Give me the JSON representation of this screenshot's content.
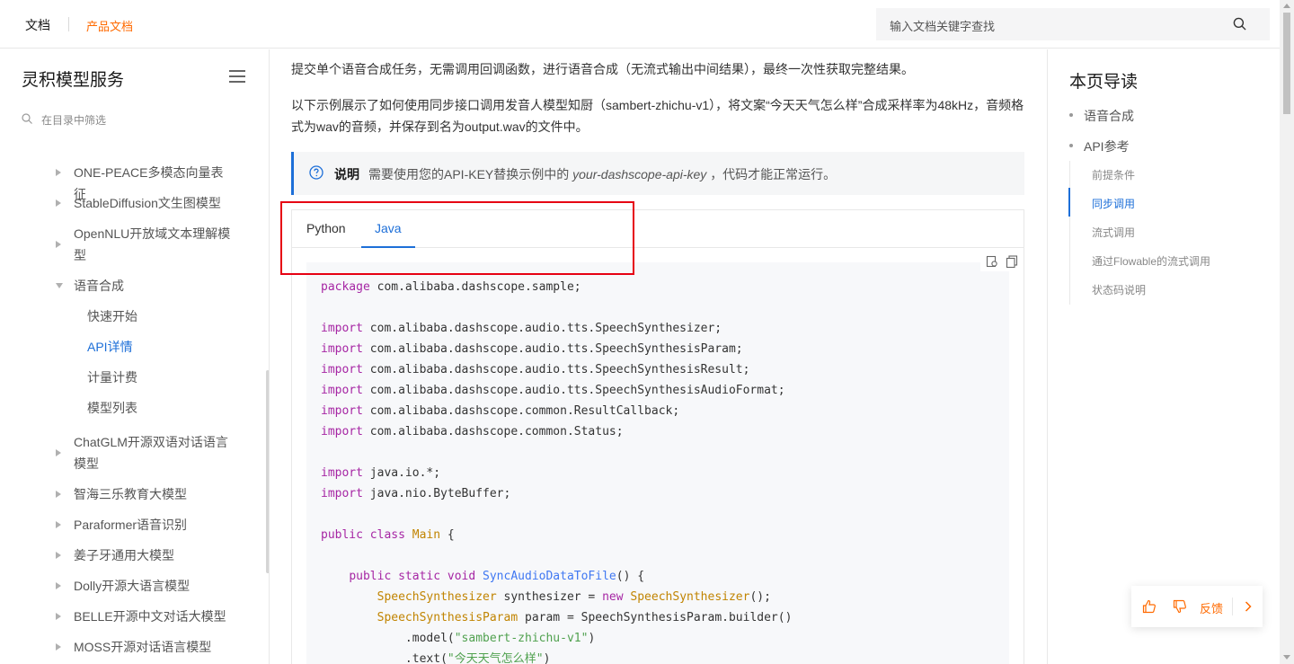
{
  "header": {
    "brand": "文档",
    "product": "产品文档",
    "search_placeholder": "输入文档关键字查找",
    "search_icon": "search-icon"
  },
  "sidebar": {
    "title": "灵积模型服务",
    "filter_placeholder": "在目录中筛选",
    "items": [
      {
        "label": "ONE-PEACE多模态向量表征",
        "expanded": false
      },
      {
        "label": "StableDiffusion文生图模型",
        "expanded": false
      },
      {
        "label": "OpenNLU开放域文本理解模型",
        "expanded": false
      },
      {
        "label": "语音合成",
        "expanded": true
      },
      {
        "label": "ChatGLM开源双语对话语言模型",
        "expanded": false
      },
      {
        "label": "智海三乐教育大模型",
        "expanded": false
      },
      {
        "label": "Paraformer语音识别",
        "expanded": false
      },
      {
        "label": "姜子牙通用大模型",
        "expanded": false
      },
      {
        "label": "Dolly开源大语言模型",
        "expanded": false
      },
      {
        "label": "BELLE开源中文对话大模型",
        "expanded": false
      },
      {
        "label": "MOSS开源对话语言模型",
        "expanded": false
      }
    ],
    "sub_items": [
      {
        "label": "快速开始",
        "active": false
      },
      {
        "label": "API详情",
        "active": true
      },
      {
        "label": "计量计费",
        "active": false
      },
      {
        "label": "模型列表",
        "active": false
      }
    ]
  },
  "content": {
    "para1": "提交单个语音合成任务，无需调用回调函数，进行语音合成（无流式输出中间结果），最终一次性获取完整结果。",
    "para2": "以下示例展示了如何使用同步接口调用发音人模型知厨（sambert-zhichu-v1），将文案“今天天气怎么样”合成采样率为48kHz，音频格式为wav的音频，并保存到名为output.wav的文件中。",
    "note_label": "说明",
    "note_text_before": "需要使用您的API-KEY替换示例中的",
    "note_text_italic": "your-dashscope-api-key",
    "note_text_after": "，代码才能正常运行。",
    "tabs": [
      {
        "label": "Python",
        "active": false
      },
      {
        "label": "Java",
        "active": true
      }
    ],
    "code": {
      "l1_kw": "package",
      "l1": " com.alibaba.dashscope.sample;",
      "imp": "import",
      "i1": " com.alibaba.dashscope.audio.tts.SpeechSynthesizer;",
      "i2": " com.alibaba.dashscope.audio.tts.SpeechSynthesisParam;",
      "i3": " com.alibaba.dashscope.audio.tts.SpeechSynthesisResult;",
      "i4": " com.alibaba.dashscope.audio.tts.SpeechSynthesisAudioFormat;",
      "i5": " com.alibaba.dashscope.common.ResultCallback;",
      "i6": " com.alibaba.dashscope.common.Status;",
      "i7": " java.io.*;",
      "i8": " java.nio.ByteBuffer;",
      "cls_kw": "public class",
      "cls_name": "Main",
      "cls_end": " {",
      "m_kw": "public static void",
      "m_name": "SyncAudioDataToFile",
      "m_end": "() {",
      "s1_ty": "SpeechSynthesizer",
      "s1_var": " synthesizer = ",
      "s1_new": "new",
      "s1_ty2": "SpeechSynthesizer",
      "s1_end": "();",
      "s2_ty": "SpeechSynthesisParam",
      "s2_rest": " param = SpeechSynthesisParam.builder()",
      "s3_pre": "  .model(",
      "s3_str": "\"sambert-zhichu-v1\"",
      "s3_end": ")",
      "s4_pre": "  .text(",
      "s4_str": "\"今天天气怎么样\"",
      "s4_end": ")"
    }
  },
  "toc": {
    "title": "本页导读",
    "level1": [
      {
        "label": "语音合成"
      },
      {
        "label": "API参考"
      }
    ],
    "level2": [
      {
        "label": "前提条件",
        "active": false
      },
      {
        "label": "同步调用",
        "active": true
      },
      {
        "label": "流式调用",
        "active": false
      },
      {
        "label": "通过Flowable的流式调用",
        "active": false
      },
      {
        "label": "状态码说明",
        "active": false
      }
    ]
  },
  "feedback": {
    "label": "反馈"
  },
  "colors": {
    "accent": "#1d6fd8",
    "brand_orange": "#ff6a00",
    "highlight_red": "#e60012"
  }
}
